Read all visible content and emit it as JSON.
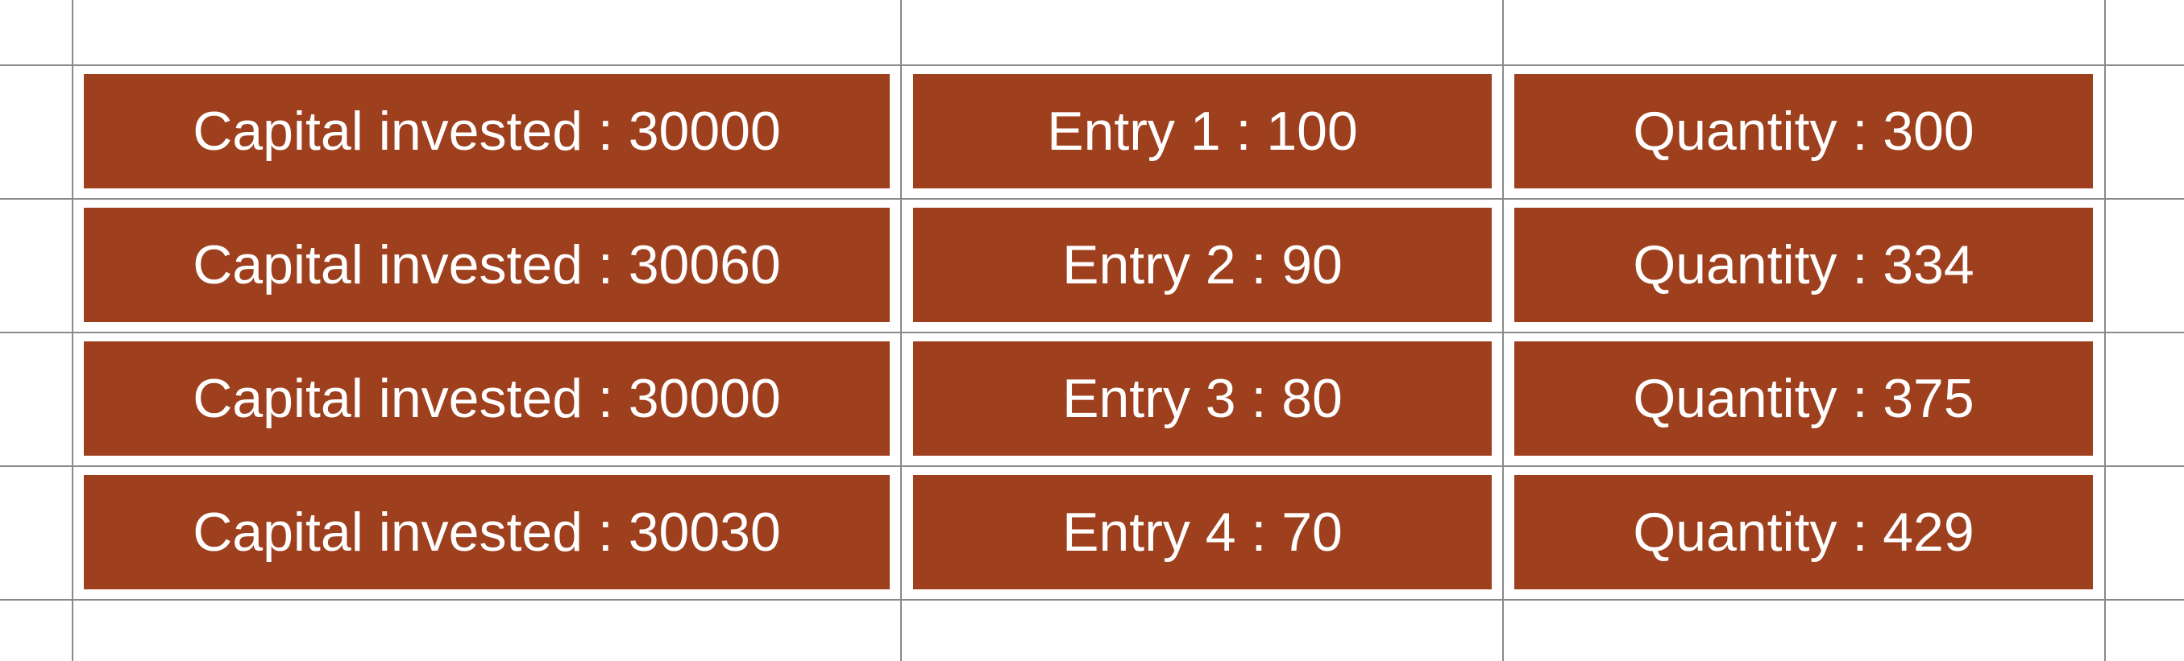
{
  "colors": {
    "cell_fill": "#9e3f1d",
    "cell_text": "#ffffff",
    "grid_line": "#8a8a8a",
    "background": "#ffffff"
  },
  "rows": [
    {
      "capital": "Capital invested : 30000",
      "entry": "Entry 1 : 100",
      "quantity": "Quantity : 300"
    },
    {
      "capital": "Capital invested : 30060",
      "entry": "Entry 2 : 90",
      "quantity": "Quantity : 334"
    },
    {
      "capital": "Capital invested : 30000",
      "entry": "Entry 3 : 80",
      "quantity": "Quantity : 375"
    },
    {
      "capital": "Capital invested : 30030",
      "entry": "Entry 4 : 70",
      "quantity": "Quantity : 429"
    }
  ]
}
